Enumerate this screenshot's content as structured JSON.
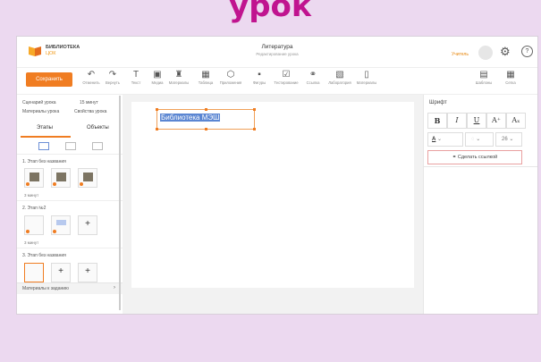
{
  "slide_heading": "урок",
  "header": {
    "logo_line1": "БИБЛИОТЕКА",
    "logo_line2": "ЦОК",
    "doc_title": "Литература",
    "doc_subtitle": "Редактирование урока",
    "user_role": "Учитель"
  },
  "toolbar": {
    "save_label": "Сохранить",
    "tools": [
      {
        "icon": "undo-icon",
        "glyph": "↶",
        "label": "Отменить"
      },
      {
        "icon": "redo-icon",
        "glyph": "↷",
        "label": "Вернуть"
      },
      {
        "icon": "text-icon",
        "glyph": "T",
        "label": "Текст"
      },
      {
        "icon": "media-icon",
        "glyph": "▣",
        "label": "Медиа"
      },
      {
        "icon": "materials-icon",
        "glyph": "♜",
        "label": "Материалы"
      },
      {
        "icon": "table-icon",
        "glyph": "▦",
        "label": "Таблица"
      },
      {
        "icon": "cube-icon",
        "glyph": "⬡",
        "label": "Приложения"
      },
      {
        "icon": "shapes-icon",
        "glyph": "▪",
        "label": "Фигуры"
      },
      {
        "icon": "test-icon",
        "glyph": "☑",
        "label": "Тестирование"
      },
      {
        "icon": "link-icon",
        "glyph": "⚭",
        "label": "Ссылка"
      },
      {
        "icon": "lab-icon",
        "glyph": "▧",
        "label": "Лаборатория"
      },
      {
        "icon": "file-icon",
        "glyph": "▯",
        "label": "Материалы"
      }
    ],
    "right_tools": [
      {
        "icon": "template-icon",
        "glyph": "▤",
        "label": "Шаблоны"
      },
      {
        "icon": "grid-icon",
        "glyph": "▦",
        "label": "Сетка"
      }
    ]
  },
  "sidebar": {
    "scenario_label": "Сценарий урока",
    "time_total": "15 минут",
    "materials_label": "Материалы урока",
    "props_label": "Свойства урока",
    "tabs": [
      "Этапы",
      "Объекты"
    ],
    "stages": [
      {
        "title": "1. Этап без названия",
        "time": "3 минут"
      },
      {
        "title": "2. Этап №2",
        "time": "3 минут"
      },
      {
        "title": "3. Этап без названия",
        "time": ""
      }
    ],
    "materials_bar": "Материалы к заданию"
  },
  "canvas": {
    "text_value": "Библиотека МЭШ"
  },
  "right_panel": {
    "font_title": "Шрифт",
    "buttons": [
      "B",
      "I",
      "U",
      "A⁺",
      "Aₓ"
    ],
    "font_size": "26",
    "make_link": "Сделать ссылкой"
  }
}
